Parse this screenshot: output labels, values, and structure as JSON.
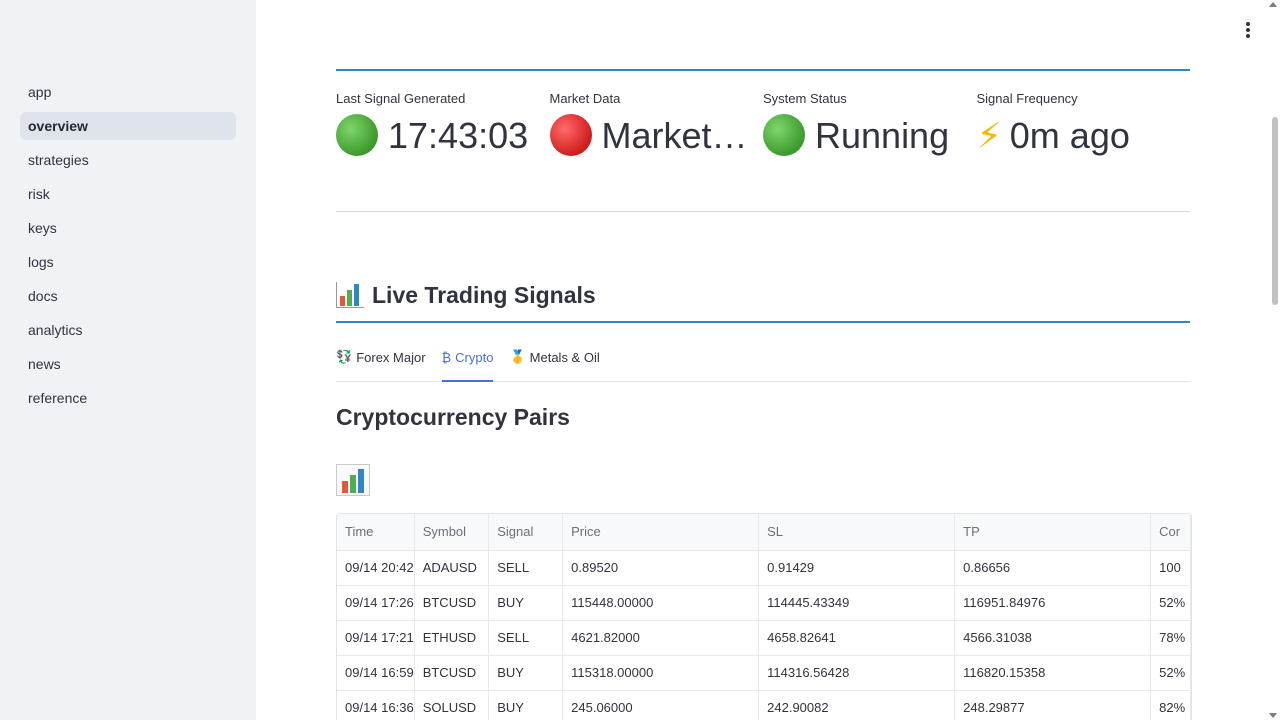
{
  "sidebar": {
    "items": [
      {
        "label": "app"
      },
      {
        "label": "overview",
        "active": true
      },
      {
        "label": "strategies"
      },
      {
        "label": "risk"
      },
      {
        "label": "keys"
      },
      {
        "label": "logs"
      },
      {
        "label": "docs"
      },
      {
        "label": "analytics"
      },
      {
        "label": "news"
      },
      {
        "label": "reference"
      }
    ]
  },
  "metrics": [
    {
      "label": "Last Signal Generated",
      "icon": "green-circle",
      "value": "17:43:03"
    },
    {
      "label": "Market Data",
      "icon": "red-circle",
      "value": "Market …"
    },
    {
      "label": "System Status",
      "icon": "green-circle",
      "value": "Running"
    },
    {
      "label": "Signal Frequency",
      "icon": "lightning-bolt",
      "value": "0m ago"
    }
  ],
  "section": {
    "title": "Live Trading Signals",
    "icon": "bar-chart-icon"
  },
  "tabs": [
    {
      "icon": "💱",
      "label": "Forex Major"
    },
    {
      "icon": "₿",
      "label": "Crypto",
      "active": true
    },
    {
      "icon": "🥇",
      "label": "Metals & Oil"
    }
  ],
  "subsection": {
    "title": "Cryptocurrency Pairs"
  },
  "table": {
    "headers": [
      "Time",
      "Symbol",
      "Signal",
      "Price",
      "SL",
      "TP",
      "Cor"
    ],
    "rows": [
      [
        "09/14 20:42",
        "ADAUSD",
        "SELL",
        "0.89520",
        "0.91429",
        "0.86656",
        "100"
      ],
      [
        "09/14 17:26",
        "BTCUSD",
        "BUY",
        "115448.00000",
        "114445.43349",
        "116951.84976",
        "52%"
      ],
      [
        "09/14 17:21",
        "ETHUSD",
        "SELL",
        "4621.82000",
        "4658.82641",
        "4566.31038",
        "78%"
      ],
      [
        "09/14 16:59",
        "BTCUSD",
        "BUY",
        "115318.00000",
        "114316.56428",
        "116820.15358",
        "52%"
      ],
      [
        "09/14 16:36",
        "SOLUSD",
        "BUY",
        "245.06000",
        "242.90082",
        "248.29877",
        "82%"
      ]
    ]
  },
  "colors": {
    "accent": "#4a6ee0",
    "divider_blue": "#2f86c8",
    "sidebar_bg": "#f0f2f6",
    "green": "#3d9a2c",
    "red": "#d01d1d"
  }
}
